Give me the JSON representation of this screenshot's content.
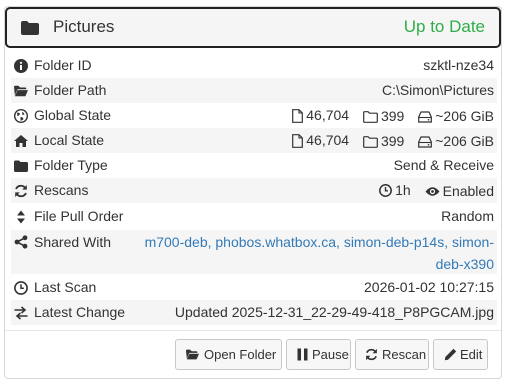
{
  "header": {
    "title": "Pictures",
    "status": "Up to Date",
    "status_color": "#2eae48",
    "icon": "folder-icon"
  },
  "rows": {
    "folder_id": {
      "label": "Folder ID",
      "value": "szktl-nze34",
      "icon": "info-circle-icon"
    },
    "folder_path": {
      "label": "Folder Path",
      "value": "C:\\Simon\\Pictures",
      "icon": "folder-open-icon"
    },
    "global_state": {
      "label": "Global State",
      "files": "46,704",
      "dirs": "399",
      "size": "~206 GiB",
      "icon": "globe-icon"
    },
    "local_state": {
      "label": "Local State",
      "files": "46,704",
      "dirs": "399",
      "size": "~206 GiB",
      "icon": "home-icon"
    },
    "folder_type": {
      "label": "Folder Type",
      "value": "Send & Receive",
      "icon": "folder-icon"
    },
    "rescans": {
      "label": "Rescans",
      "interval": "1h",
      "watcher": "Enabled",
      "icon": "refresh-icon"
    },
    "pull_order": {
      "label": "File Pull Order",
      "value": "Random",
      "icon": "sort-icon"
    },
    "shared_with": {
      "label": "Shared With",
      "devices": [
        "m700-deb",
        "phobos.whatbox.ca",
        "simon-deb-p14s",
        "simon-deb-x390"
      ],
      "icon": "share-icon"
    },
    "last_scan": {
      "label": "Last Scan",
      "value": "2026-01-02 10:27:15",
      "icon": "clock-icon"
    },
    "latest_change": {
      "label": "Latest Change",
      "value": "Updated 2025-12-31_22-29-49-418_P8PGCAM.jpg",
      "icon": "exchange-icon"
    }
  },
  "buttons": {
    "open_folder": "Open Folder",
    "pause": "Pause",
    "rescan": "Rescan",
    "edit": "Edit"
  }
}
